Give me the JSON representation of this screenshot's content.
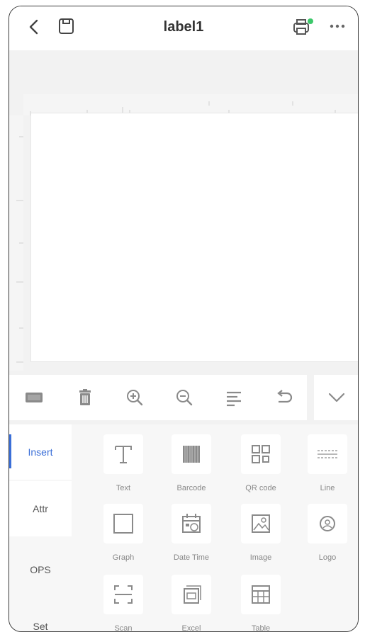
{
  "header": {
    "title": "label1",
    "icons": {
      "back": "chevron-left-icon",
      "save": "save-icon",
      "printer": "printer-icon",
      "more": "more-icon"
    },
    "printer_status_color": "#3cc86a"
  },
  "toolbar": {
    "items": [
      {
        "icon": "label-size-icon"
      },
      {
        "icon": "delete-icon"
      },
      {
        "icon": "zoom-in-icon"
      },
      {
        "icon": "zoom-out-icon"
      },
      {
        "icon": "align-icon"
      },
      {
        "icon": "undo-icon"
      }
    ],
    "collapse_icon": "chevron-down-icon"
  },
  "side_tabs": [
    {
      "label": "Insert",
      "active": true
    },
    {
      "label": "Attr",
      "active": false
    },
    {
      "label": "OPS",
      "active": false
    },
    {
      "label": "Set",
      "active": false
    }
  ],
  "tools": [
    {
      "label": "Text",
      "icon": "text-icon"
    },
    {
      "label": "Barcode",
      "icon": "barcode-icon"
    },
    {
      "label": "QR code",
      "icon": "qr-code-icon"
    },
    {
      "label": "Line",
      "icon": "line-icon"
    },
    {
      "label": "Graph",
      "icon": "graph-icon"
    },
    {
      "label": "Date Time",
      "icon": "calendar-icon"
    },
    {
      "label": "Image",
      "icon": "image-icon"
    },
    {
      "label": "Logo",
      "icon": "logo-icon"
    },
    {
      "label": "Scan",
      "icon": "scan-icon"
    },
    {
      "label": "Excel",
      "icon": "excel-icon"
    },
    {
      "label": "Table",
      "icon": "table-icon"
    }
  ],
  "colors": {
    "accent": "#3b6fd8",
    "icon_gray": "#8a8a8a"
  }
}
